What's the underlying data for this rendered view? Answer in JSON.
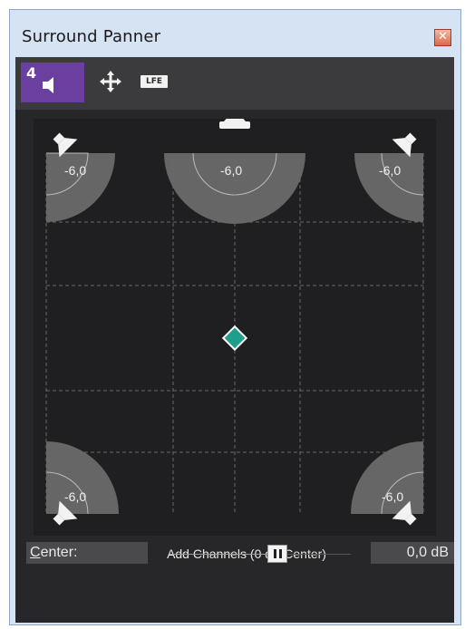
{
  "window": {
    "title": "Surround Panner",
    "close_glyph": "✕"
  },
  "toolbar": {
    "mode_number": "4",
    "mode_icon": "speaker-icon",
    "move_icon": "move-arrows-icon",
    "lfe_label": "LFE"
  },
  "panner": {
    "speakers": {
      "front_left": "-6,0",
      "center": "-6,0",
      "front_right": "-6,0",
      "rear_left": "-6,0",
      "rear_right": "-6,0"
    },
    "add_channels_label": "Add Channels (0 dB Center)",
    "accent_color": "#1e9f8a"
  },
  "center_control": {
    "label_first": "C",
    "label_rest": "enter:",
    "value": "0,0 dB"
  }
}
